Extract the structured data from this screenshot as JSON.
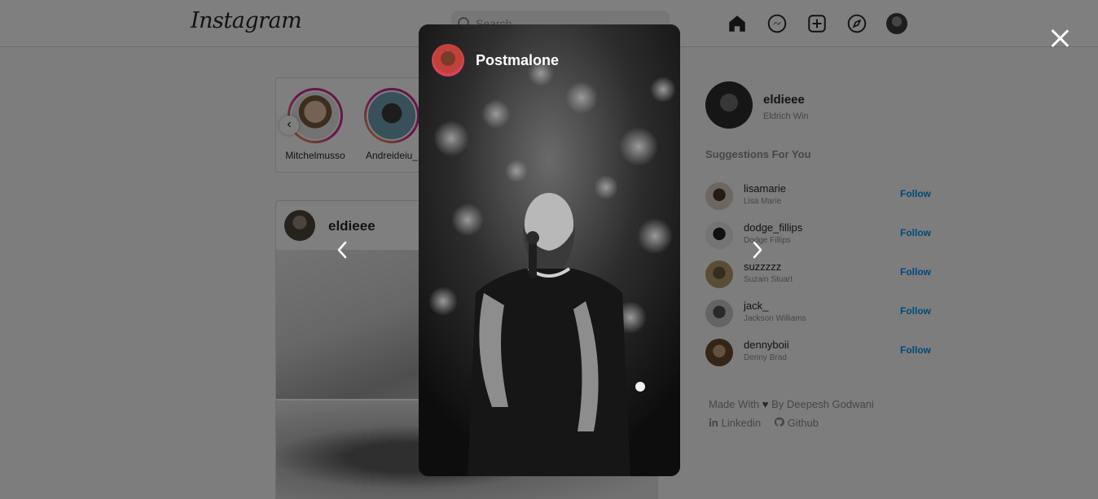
{
  "app": {
    "logo_text": "Instagram"
  },
  "search": {
    "placeholder": "Search"
  },
  "nav": {
    "icons": [
      "home-icon",
      "messenger-icon",
      "new-post-icon",
      "explore-icon",
      "profile-avatar"
    ]
  },
  "stories": {
    "items": [
      {
        "label": "Mitchelmusso"
      },
      {
        "label": "Andreideiu_"
      }
    ]
  },
  "feed": {
    "post": {
      "username": "eldieee"
    }
  },
  "sidebar": {
    "me": {
      "username": "eldieee",
      "name": "Eldrich Win"
    },
    "suggestions_title": "Suggestions For You",
    "suggestions": [
      {
        "username": "lisamarie",
        "name": "Lisa Marie",
        "action": "Follow"
      },
      {
        "username": "dodge_fillips",
        "name": "Dodge Fillips",
        "action": "Follow"
      },
      {
        "username": "suzzzzz",
        "name": "Suzain Stuart",
        "action": "Follow"
      },
      {
        "username": "jack_",
        "name": "Jackson Williams",
        "action": "Follow"
      },
      {
        "username": "dennyboii",
        "name": "Denny Brad",
        "action": "Follow"
      }
    ],
    "footer": {
      "made_with": "Made With",
      "by": "By Deepesh Godwani",
      "linkedin": "Linkedin",
      "github": "Github"
    }
  },
  "story_viewer": {
    "username": "Postmalone"
  },
  "colors": {
    "follow_blue": "#0095f6",
    "overlay": "rgba(0,0,0,0.5)"
  }
}
